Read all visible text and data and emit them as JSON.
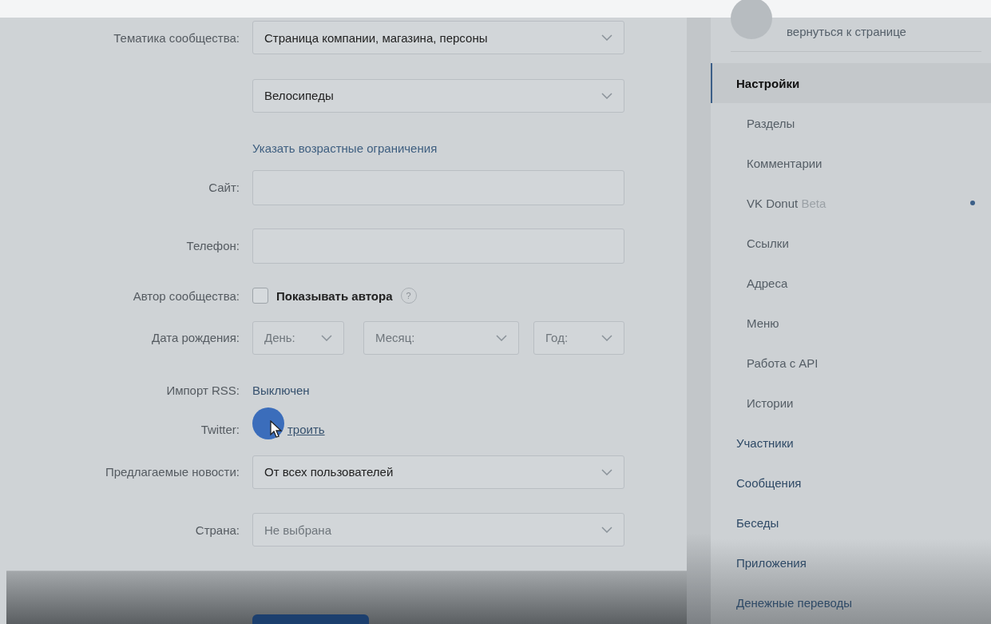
{
  "form": {
    "rows": [
      {
        "kind": "select",
        "label": "Тематика сообщества:",
        "value": "Страница компании, магазина, персоны",
        "placeholder": false
      },
      {
        "kind": "select",
        "value": "Велосипеды",
        "placeholder": false
      },
      {
        "kind": "link",
        "value": "Указать возрастные ограничения"
      },
      {
        "kind": "input",
        "label": "Сайт:"
      },
      {
        "kind": "input",
        "label": "Телефон:"
      },
      {
        "kind": "checkbox",
        "label": "Автор сообщества:",
        "value": "Показывать автора",
        "checked": false,
        "help": "?"
      },
      {
        "kind": "date",
        "label": "Дата рождения:",
        "parts": [
          "День:",
          "Месяц:",
          "Год:"
        ]
      },
      {
        "kind": "status",
        "label": "Импорт RSS:",
        "value": "Выключен"
      },
      {
        "kind": "action",
        "label": "Twitter:",
        "value": "троить"
      },
      {
        "kind": "select",
        "label": "Предлагаемые новости:",
        "value": "От всех пользователей",
        "placeholder": false
      },
      {
        "kind": "select",
        "label": "Страна:",
        "value": "Не выбрана",
        "placeholder": true
      }
    ]
  },
  "sidebar": {
    "back_link": "вернуться к странице",
    "items": [
      {
        "kind": "top",
        "label": "Настройки",
        "selected": true
      },
      {
        "kind": "sub",
        "label": "Разделы",
        "selected": false
      },
      {
        "kind": "sub",
        "label": "Комментарии",
        "selected": false
      },
      {
        "kind": "sub",
        "label": "VK Donut **Beta**",
        "selected": false,
        "dot": true
      },
      {
        "kind": "sub",
        "label": "Ссылки",
        "selected": false
      },
      {
        "kind": "sub",
        "label": "Адреса",
        "selected": false
      },
      {
        "kind": "sub",
        "label": "Меню",
        "selected": false
      },
      {
        "kind": "sub",
        "label": "Работа с API",
        "selected": false
      },
      {
        "kind": "sub",
        "label": "Истории",
        "selected": false
      },
      {
        "kind": "top",
        "label": "Участники",
        "selected": false
      },
      {
        "kind": "top",
        "label": "Сообщения",
        "selected": false
      },
      {
        "kind": "top",
        "label": "Беседы",
        "selected": false
      },
      {
        "kind": "top",
        "label": "Приложения",
        "selected": false
      },
      {
        "kind": "top",
        "label": "Денежные переводы",
        "selected": false
      }
    ]
  }
}
